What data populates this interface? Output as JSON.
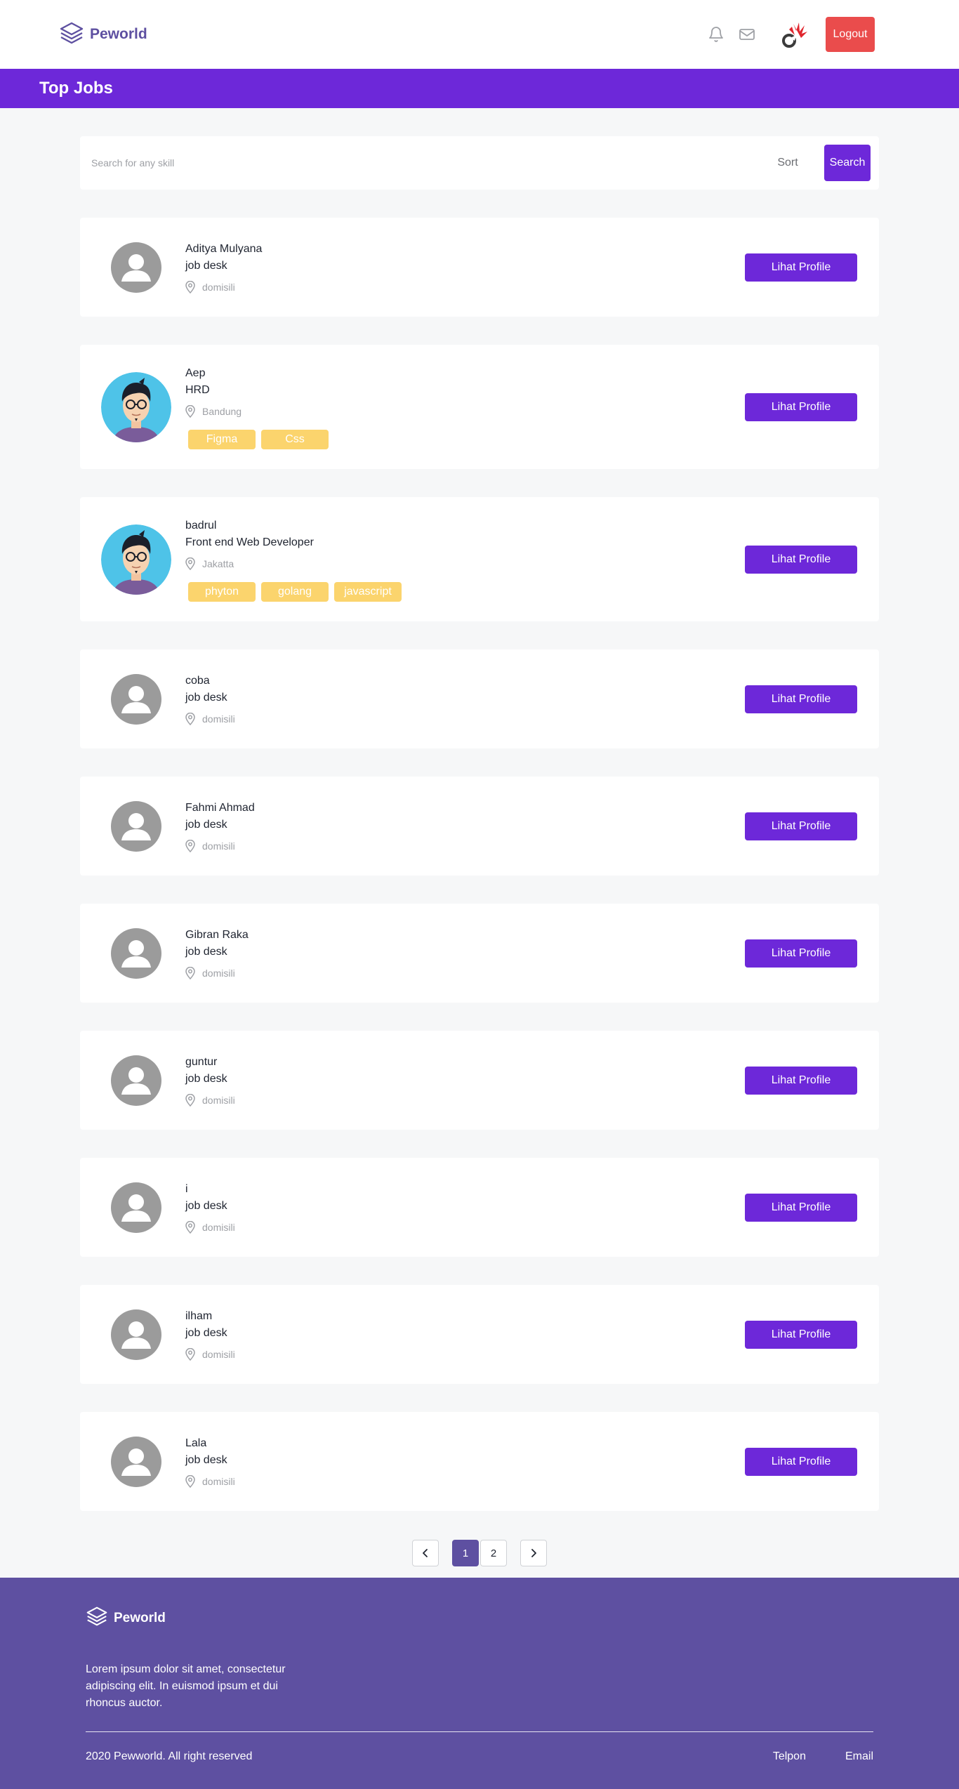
{
  "header": {
    "brand": "Peworld",
    "logout_label": "Logout",
    "colors": {
      "primary": "#6d28d9",
      "brand": "#5e50a1",
      "logout": "#ea4c4c",
      "skill": "#fbd46d"
    }
  },
  "page_title": "Top Jobs",
  "search": {
    "placeholder": "Search for any skill",
    "value": "",
    "sort_label": "Sort",
    "button_label": "Search"
  },
  "profile_button_label": "Lihat Profile",
  "candidates": [
    {
      "name": "Aditya Mulyana",
      "job": "job desk",
      "location": "domisili",
      "avatar": "default-avatar-icon",
      "skills": []
    },
    {
      "name": "Aep",
      "job": "HRD",
      "location": "Bandung",
      "avatar": "cartoon-avatar-icon",
      "skills": [
        "Figma",
        "Css"
      ]
    },
    {
      "name": "badrul",
      "job": "Front end Web Developer",
      "location": "Jakatta",
      "avatar": "cartoon-avatar-icon",
      "skills": [
        "phyton",
        "golang",
        "javascript"
      ]
    },
    {
      "name": "coba",
      "job": "job desk",
      "location": "domisili",
      "avatar": "default-avatar-icon",
      "skills": []
    },
    {
      "name": "Fahmi Ahmad",
      "job": "job desk",
      "location": "domisili",
      "avatar": "default-avatar-icon",
      "skills": []
    },
    {
      "name": "Gibran Raka",
      "job": "job desk",
      "location": "domisili",
      "avatar": "default-avatar-icon",
      "skills": []
    },
    {
      "name": "guntur",
      "job": "job desk",
      "location": "domisili",
      "avatar": "default-avatar-icon",
      "skills": []
    },
    {
      "name": "i",
      "job": "job desk",
      "location": "domisili",
      "avatar": "default-avatar-icon",
      "skills": []
    },
    {
      "name": "ilham",
      "job": "job desk",
      "location": "domisili",
      "avatar": "default-avatar-icon",
      "skills": []
    },
    {
      "name": "Lala",
      "job": "job desk",
      "location": "domisili",
      "avatar": "default-avatar-icon",
      "skills": []
    }
  ],
  "pagination": {
    "pages": [
      "1",
      "2"
    ],
    "current": "1"
  },
  "footer": {
    "brand": "Peworld",
    "description": "Lorem ipsum dolor sit amet, consectetur adipiscing elit. In euismod ipsum et dui rhoncus auctor.",
    "copyright": "2020 Pewworld. All right reserved",
    "links": [
      "Telpon",
      "Email"
    ]
  }
}
